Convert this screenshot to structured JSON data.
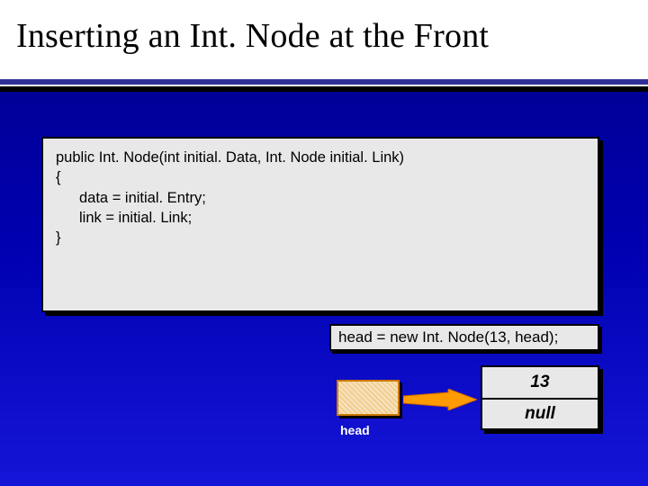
{
  "title": "Inserting an Int. Node at the Front",
  "code": {
    "sig": "public Int. Node(int initial. Data, Int. Node initial. Link)",
    "open": "{",
    "line1": "data = initial. Entry;",
    "line2": "link = initial. Link;",
    "close": "}"
  },
  "statement": "head = new Int. Node(13, head);",
  "head_label": "head",
  "node": {
    "data": "13",
    "link": "null"
  }
}
